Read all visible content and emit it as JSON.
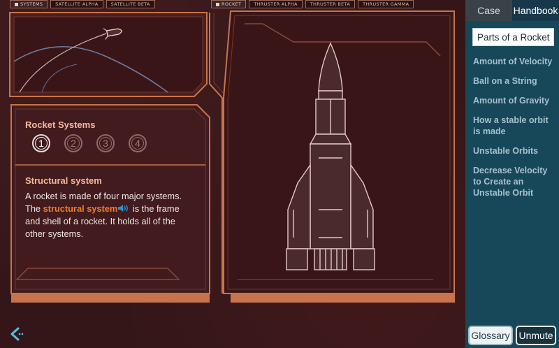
{
  "left_tabs": [
    {
      "label": "Systems",
      "active": true
    },
    {
      "label": "Satellite Alpha",
      "active": false
    },
    {
      "label": "Satellite Beta",
      "active": false
    }
  ],
  "right_tabs": [
    {
      "label": "Rocket",
      "active": true
    },
    {
      "label": "Thruster Alpha",
      "active": false
    },
    {
      "label": "Thruster Beta",
      "active": false
    },
    {
      "label": "Thruster Gamma",
      "active": false
    }
  ],
  "panel": {
    "title": "Rocket Systems",
    "steps": [
      "1",
      "2",
      "3",
      "4"
    ],
    "active_step": "1",
    "section_title": "Structural system",
    "body_before": "A rocket is made of four major systems. The ",
    "body_highlight": "structural system",
    "body_after": " is the frame and shell of a rocket. It holds all of the other systems."
  },
  "sidebar": {
    "tabs": [
      {
        "label": "Case",
        "active": false
      },
      {
        "label": "Handbook",
        "active": true
      }
    ],
    "current": "Parts of a Rocket",
    "items": [
      "Amount of Velocity",
      "Ball on a String",
      "Amount of Gravity",
      "How a stable orbit is made",
      "Unstable Orbits",
      "Decrease Velocity to Create an Unstable Orbit"
    ],
    "glossary": "Glossary",
    "unmute": "Unmute"
  },
  "colors": {
    "frame_orange": "#c8744a",
    "frame_dark": "#6e3a2e",
    "highlight": "#f07d2a",
    "sidebar_bg": "#16485a"
  },
  "icons": {
    "back": "back-arrow-icon",
    "speaker": "speaker-icon"
  }
}
